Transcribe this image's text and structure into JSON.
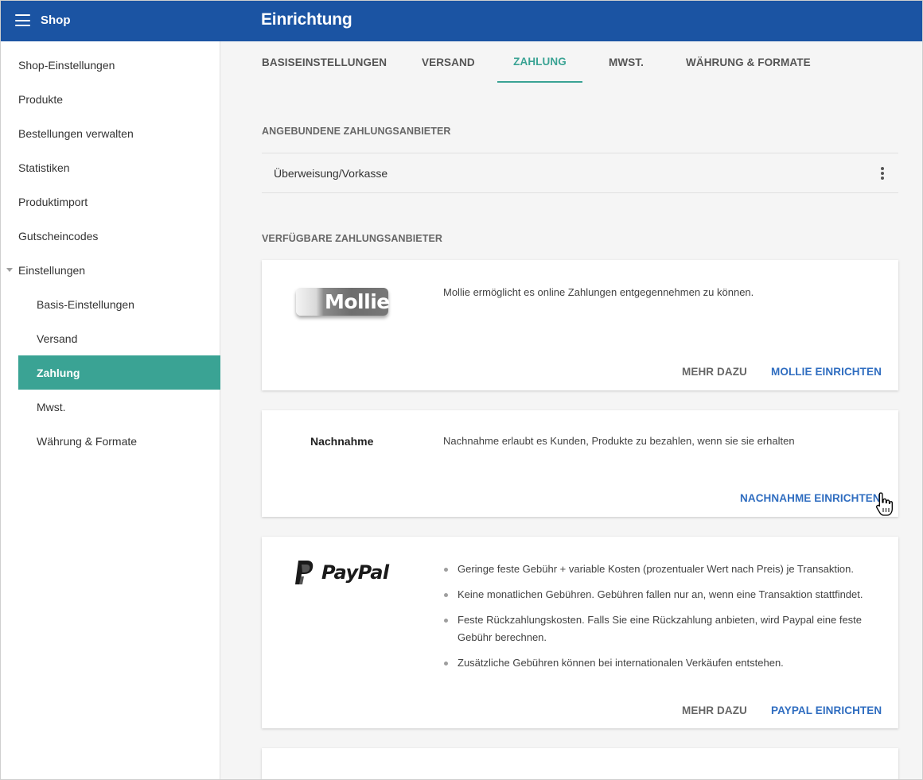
{
  "header": {
    "app_title": "Shop",
    "page_title": "Einrichtung"
  },
  "sidebar": {
    "items": [
      {
        "label": "Shop-Einstellungen"
      },
      {
        "label": "Produkte"
      },
      {
        "label": "Bestellungen verwalten"
      },
      {
        "label": "Statistiken"
      },
      {
        "label": "Produktimport"
      },
      {
        "label": "Gutscheincodes"
      },
      {
        "label": "Einstellungen",
        "expanded": true
      }
    ],
    "sub_items": [
      {
        "label": "Basis-Einstellungen"
      },
      {
        "label": "Versand"
      },
      {
        "label": "Zahlung",
        "active": true
      },
      {
        "label": "Mwst."
      },
      {
        "label": "Währung & Formate"
      }
    ]
  },
  "tabs": [
    {
      "label": "BASISEINSTELLUNGEN"
    },
    {
      "label": "VERSAND"
    },
    {
      "label": "ZAHLUNG",
      "active": true
    },
    {
      "label": "MWST."
    },
    {
      "label": "WÄHRUNG & FORMATE"
    }
  ],
  "linked": {
    "heading": "ANGEBUNDENE ZAHLUNGSANBIETER",
    "items": [
      {
        "name": "Überweisung/Vorkasse"
      }
    ]
  },
  "available": {
    "heading": "VERFÜGBARE ZAHLUNGSANBIETER",
    "providers": [
      {
        "logo_text": "Mollie",
        "description": "Mollie ermöglicht es online Zahlungen entgegennehmen zu können.",
        "more_label": "MEHR DAZU",
        "setup_label": "MOLLIE EINRICHTEN"
      },
      {
        "name": "Nachnahme",
        "description": "Nachnahme erlaubt es Kunden, Produkte zu bezahlen, wenn sie sie erhalten",
        "setup_label": "NACHNAHME EINRICHTEN"
      },
      {
        "logo_text": "PayPal",
        "bullets": [
          "Geringe feste Gebühr + variable Kosten (prozentualer Wert nach Preis) je Transaktion.",
          "Keine monatlichen Gebühren. Gebühren fallen nur an, wenn eine Transaktion stattfindet.",
          "Feste Rückzahlungskosten. Falls Sie eine Rückzahlung anbieten, wird Paypal eine feste Gebühr berechnen.",
          "Zusätzliche Gebühren können bei internationalen Verkäufen entstehen."
        ],
        "more_label": "MEHR DAZU",
        "setup_label": "PAYPAL EINRICHTEN"
      }
    ]
  },
  "icons": {
    "menu": "hamburger-menu-icon",
    "more": "more-vertical-icon",
    "expand": "caret-down-icon",
    "pointer": "hand-pointer-cursor"
  },
  "colors": {
    "header_bg": "#1b54a3",
    "accent": "#3aa394",
    "link_blue": "#2f6dc0",
    "page_bg": "#f5f5f5"
  }
}
